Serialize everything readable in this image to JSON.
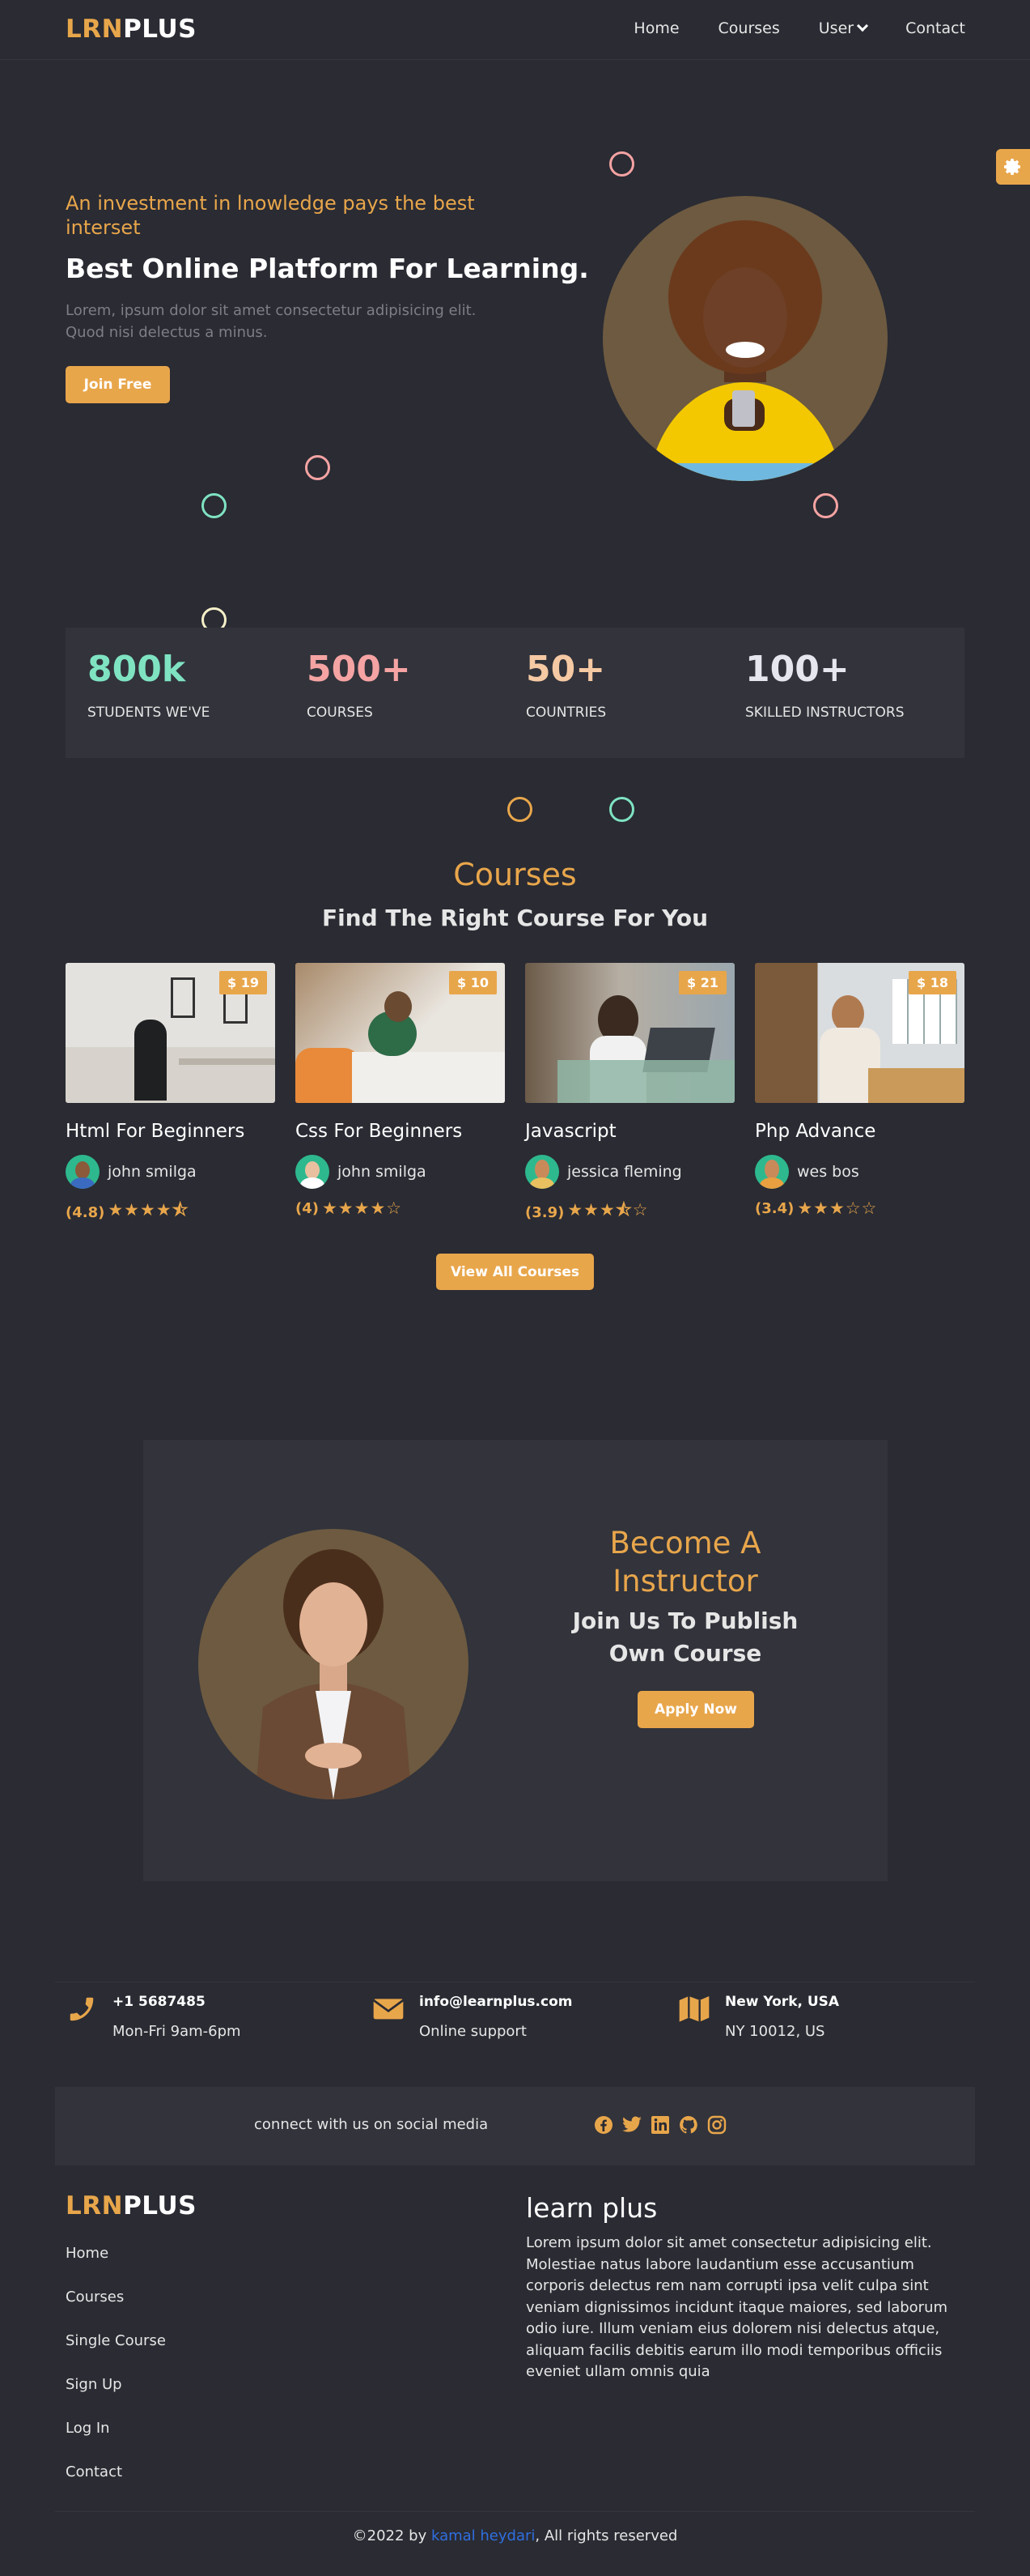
{
  "colors": {
    "accent": "#e8a64b",
    "background": "#2a2b33",
    "panel": "#32333b",
    "green": "#7fe3c2",
    "pink": "#f5a3a3",
    "link": "#2f6fe0"
  },
  "brand": {
    "logo_part1": "LRN",
    "logo_part2": "PLUS"
  },
  "nav": {
    "home": "Home",
    "courses": "Courses",
    "user": "User",
    "contact": "Contact"
  },
  "hero": {
    "subtitle": "An investment in lnowledge pays the best interset",
    "title": "Best Online Platform For Learning.",
    "description": "Lorem, ipsum dolor sit amet consectetur adipisicing elit. Quod nisi delectus a minus.",
    "join_button": "Join Free"
  },
  "stats": [
    {
      "value": "800k",
      "label": "STUDENTS WE'VE"
    },
    {
      "value": "500+",
      "label": "COURSES"
    },
    {
      "value": "50+",
      "label": "COUNTRIES"
    },
    {
      "value": "100+",
      "label": "SKILLED INSTRUCTORS"
    }
  ],
  "courses_section": {
    "title": "Courses",
    "subtitle": "Find The Right Course For You",
    "view_all": "View All Courses",
    "items": [
      {
        "price": "$ 19",
        "title": "Html For Beginners",
        "author": "john smilga",
        "rating": "(4.8)",
        "stars": "★★★★⯪"
      },
      {
        "price": "$ 10",
        "title": "Css For Beginners",
        "author": "john smilga",
        "rating": "(4)",
        "stars": "★★★★☆"
      },
      {
        "price": "$ 21",
        "title": "Javascript",
        "author": "jessica fleming",
        "rating": "(3.9)",
        "stars": "★★★⯪☆"
      },
      {
        "price": "$ 18",
        "title": "Php Advance",
        "author": "wes bos",
        "rating": "(3.4)",
        "stars": "★★★☆☆"
      }
    ]
  },
  "instructor": {
    "title": "Become A Instructor",
    "subtitle": "Join Us To Publish Own Course",
    "apply_button": "Apply Now"
  },
  "contact": [
    {
      "icon": "phone-icon",
      "line1": "+1 5687485",
      "line2": "Mon-Fri 9am-6pm"
    },
    {
      "icon": "envelope-icon",
      "line1": "info@learnplus.com",
      "line2": "Online support"
    },
    {
      "icon": "map-icon",
      "line1": "New York, USA",
      "line2": "NY 10012, US"
    }
  ],
  "social": {
    "text": "connect with us on social media",
    "icons": [
      "facebook-icon",
      "twitter-icon",
      "linkedin-icon",
      "github-icon",
      "instagram-icon"
    ]
  },
  "footer": {
    "links": [
      "Home",
      "Courses",
      "Single Course",
      "Sign Up",
      "Log In",
      "Contact"
    ],
    "about_title": "learn plus",
    "about_text": "Lorem ipsum dolor sit amet consectetur adipisicing elit. Molestiae natus labore laudantium esse accusantium corporis delectus rem nam corrupti ipsa velit culpa sint veniam dignissimos incidunt itaque maiores, sed laborum odio iure. Illum veniam eius dolorem nisi delectus atque, aliquam facilis debitis earum illo modi temporibus officiis eveniet ullam omnis quia",
    "copyright_prefix": "©2022 by",
    "copyright_author": "kamal heydari",
    "copyright_suffix": ", All rights reserved"
  }
}
